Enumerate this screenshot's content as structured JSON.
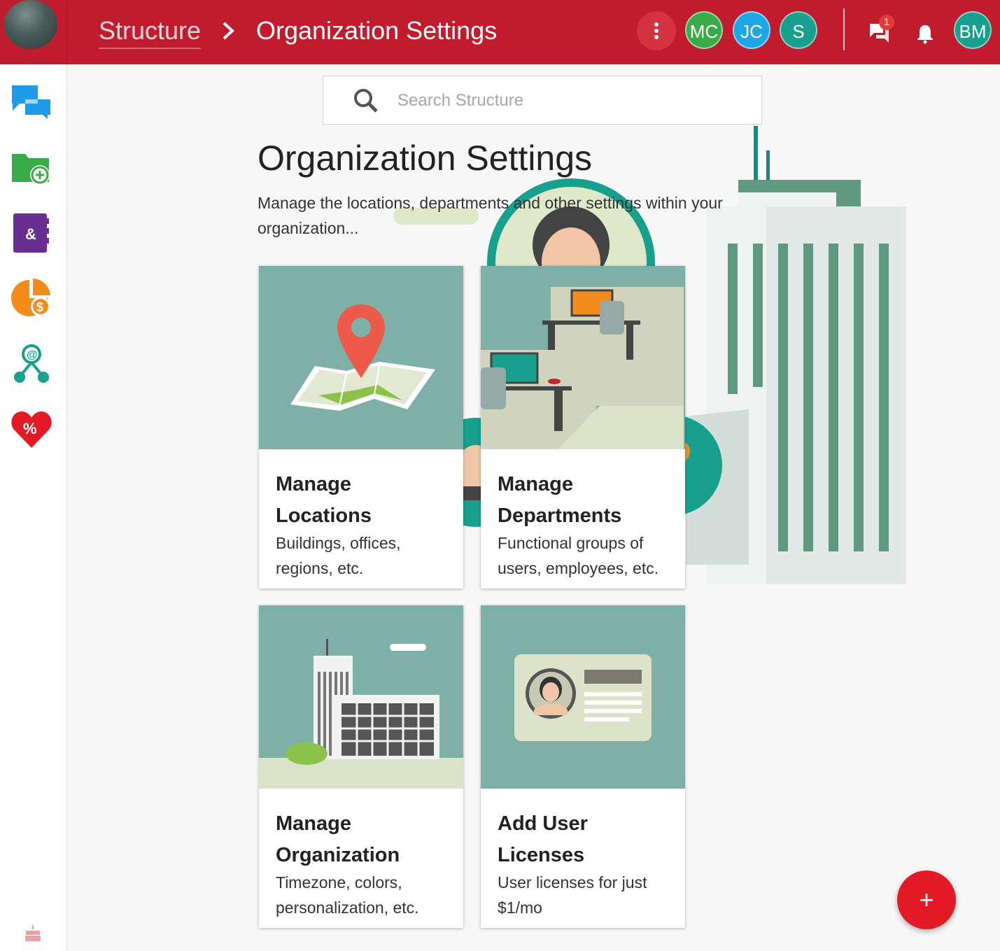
{
  "header": {
    "breadcrumb_root": "Structure",
    "breadcrumb_current": "Organization Settings",
    "avatars": [
      {
        "initials": "MC",
        "color": "#3aab49"
      },
      {
        "initials": "JC",
        "color": "#1ea6e8"
      },
      {
        "initials": "S",
        "color": "#16a08d"
      }
    ],
    "chat_badge_count": "1",
    "user_avatar": {
      "initials": "BM",
      "color": "#16a08d"
    },
    "bar_color": "#c01c2e"
  },
  "sidebar": {
    "items": [
      {
        "name": "chat-bubbles-icon",
        "color": "#1e9ce8"
      },
      {
        "name": "folder-add-icon",
        "color": "#3aab49"
      },
      {
        "name": "contacts-book-icon",
        "color": "#6a2d91"
      },
      {
        "name": "pie-chart-dollar-icon",
        "color": "#f28c1d"
      },
      {
        "name": "org-network-icon",
        "color": "#16a08d"
      },
      {
        "name": "heart-percent-icon",
        "color": "#e21b26"
      }
    ]
  },
  "search": {
    "placeholder": "Search Structure",
    "value": ""
  },
  "main": {
    "title": "Organization Settings",
    "description": "Manage the locations, departments and other settings within your organization..."
  },
  "cards": [
    {
      "title": "Manage Locations",
      "description": "Buildings, offices, regions, etc."
    },
    {
      "title": "Manage Departments",
      "description": "Functional groups of users, employees, etc."
    },
    {
      "title": "Manage Organization",
      "description": "Timezone, colors, personalization, etc."
    },
    {
      "title": "Add User Licenses",
      "description": "User licenses for just $1/mo"
    }
  ],
  "fab": {
    "label": "+"
  }
}
